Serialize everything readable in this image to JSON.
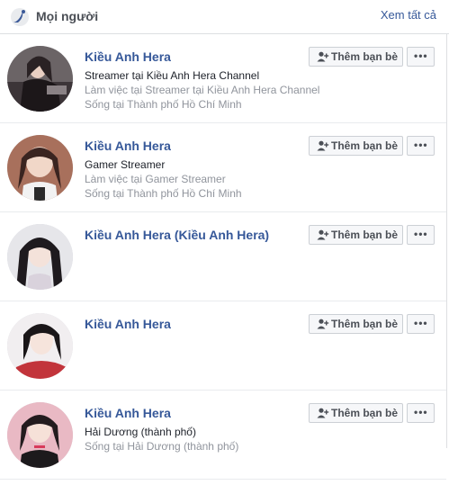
{
  "header": {
    "title": "Mọi người",
    "see_all": "Xem tất cả",
    "icon": "people-wave-icon"
  },
  "people": [
    {
      "name": "Kiều Anh Hera",
      "line1": "Streamer tại Kiều Anh Hera Channel",
      "line2": "Làm việc tại Streamer tại Kiều Anh Hera Channel",
      "line3": "Sống tại Thành phố Hồ Chí Minh",
      "add_label": "Thêm bạn bè",
      "more_label": "•••"
    },
    {
      "name": "Kiều Anh Hera",
      "line1": "Gamer Streamer",
      "line2": "Làm việc tại Gamer Streamer",
      "line3": "Sống tại Thành phố Hồ Chí Minh",
      "add_label": "Thêm bạn bè",
      "more_label": "•••"
    },
    {
      "name": "Kiều Anh Hera (Kiều Anh Hera)",
      "line1": "",
      "line2": "",
      "line3": "",
      "add_label": "Thêm bạn bè",
      "more_label": "•••"
    },
    {
      "name": "Kiều Anh Hera",
      "line1": "",
      "line2": "",
      "line3": "",
      "add_label": "Thêm bạn bè",
      "more_label": "•••"
    },
    {
      "name": "Kiều Anh Hera",
      "line1": "Hải Dương (thành phố)",
      "line2": "Sống tại Hải Dương (thành phố)",
      "line3": "",
      "add_label": "Thêm bạn bè",
      "more_label": "•••"
    }
  ],
  "colors": {
    "link": "#365899",
    "muted": "#90949c",
    "border": "#dddfe2"
  }
}
